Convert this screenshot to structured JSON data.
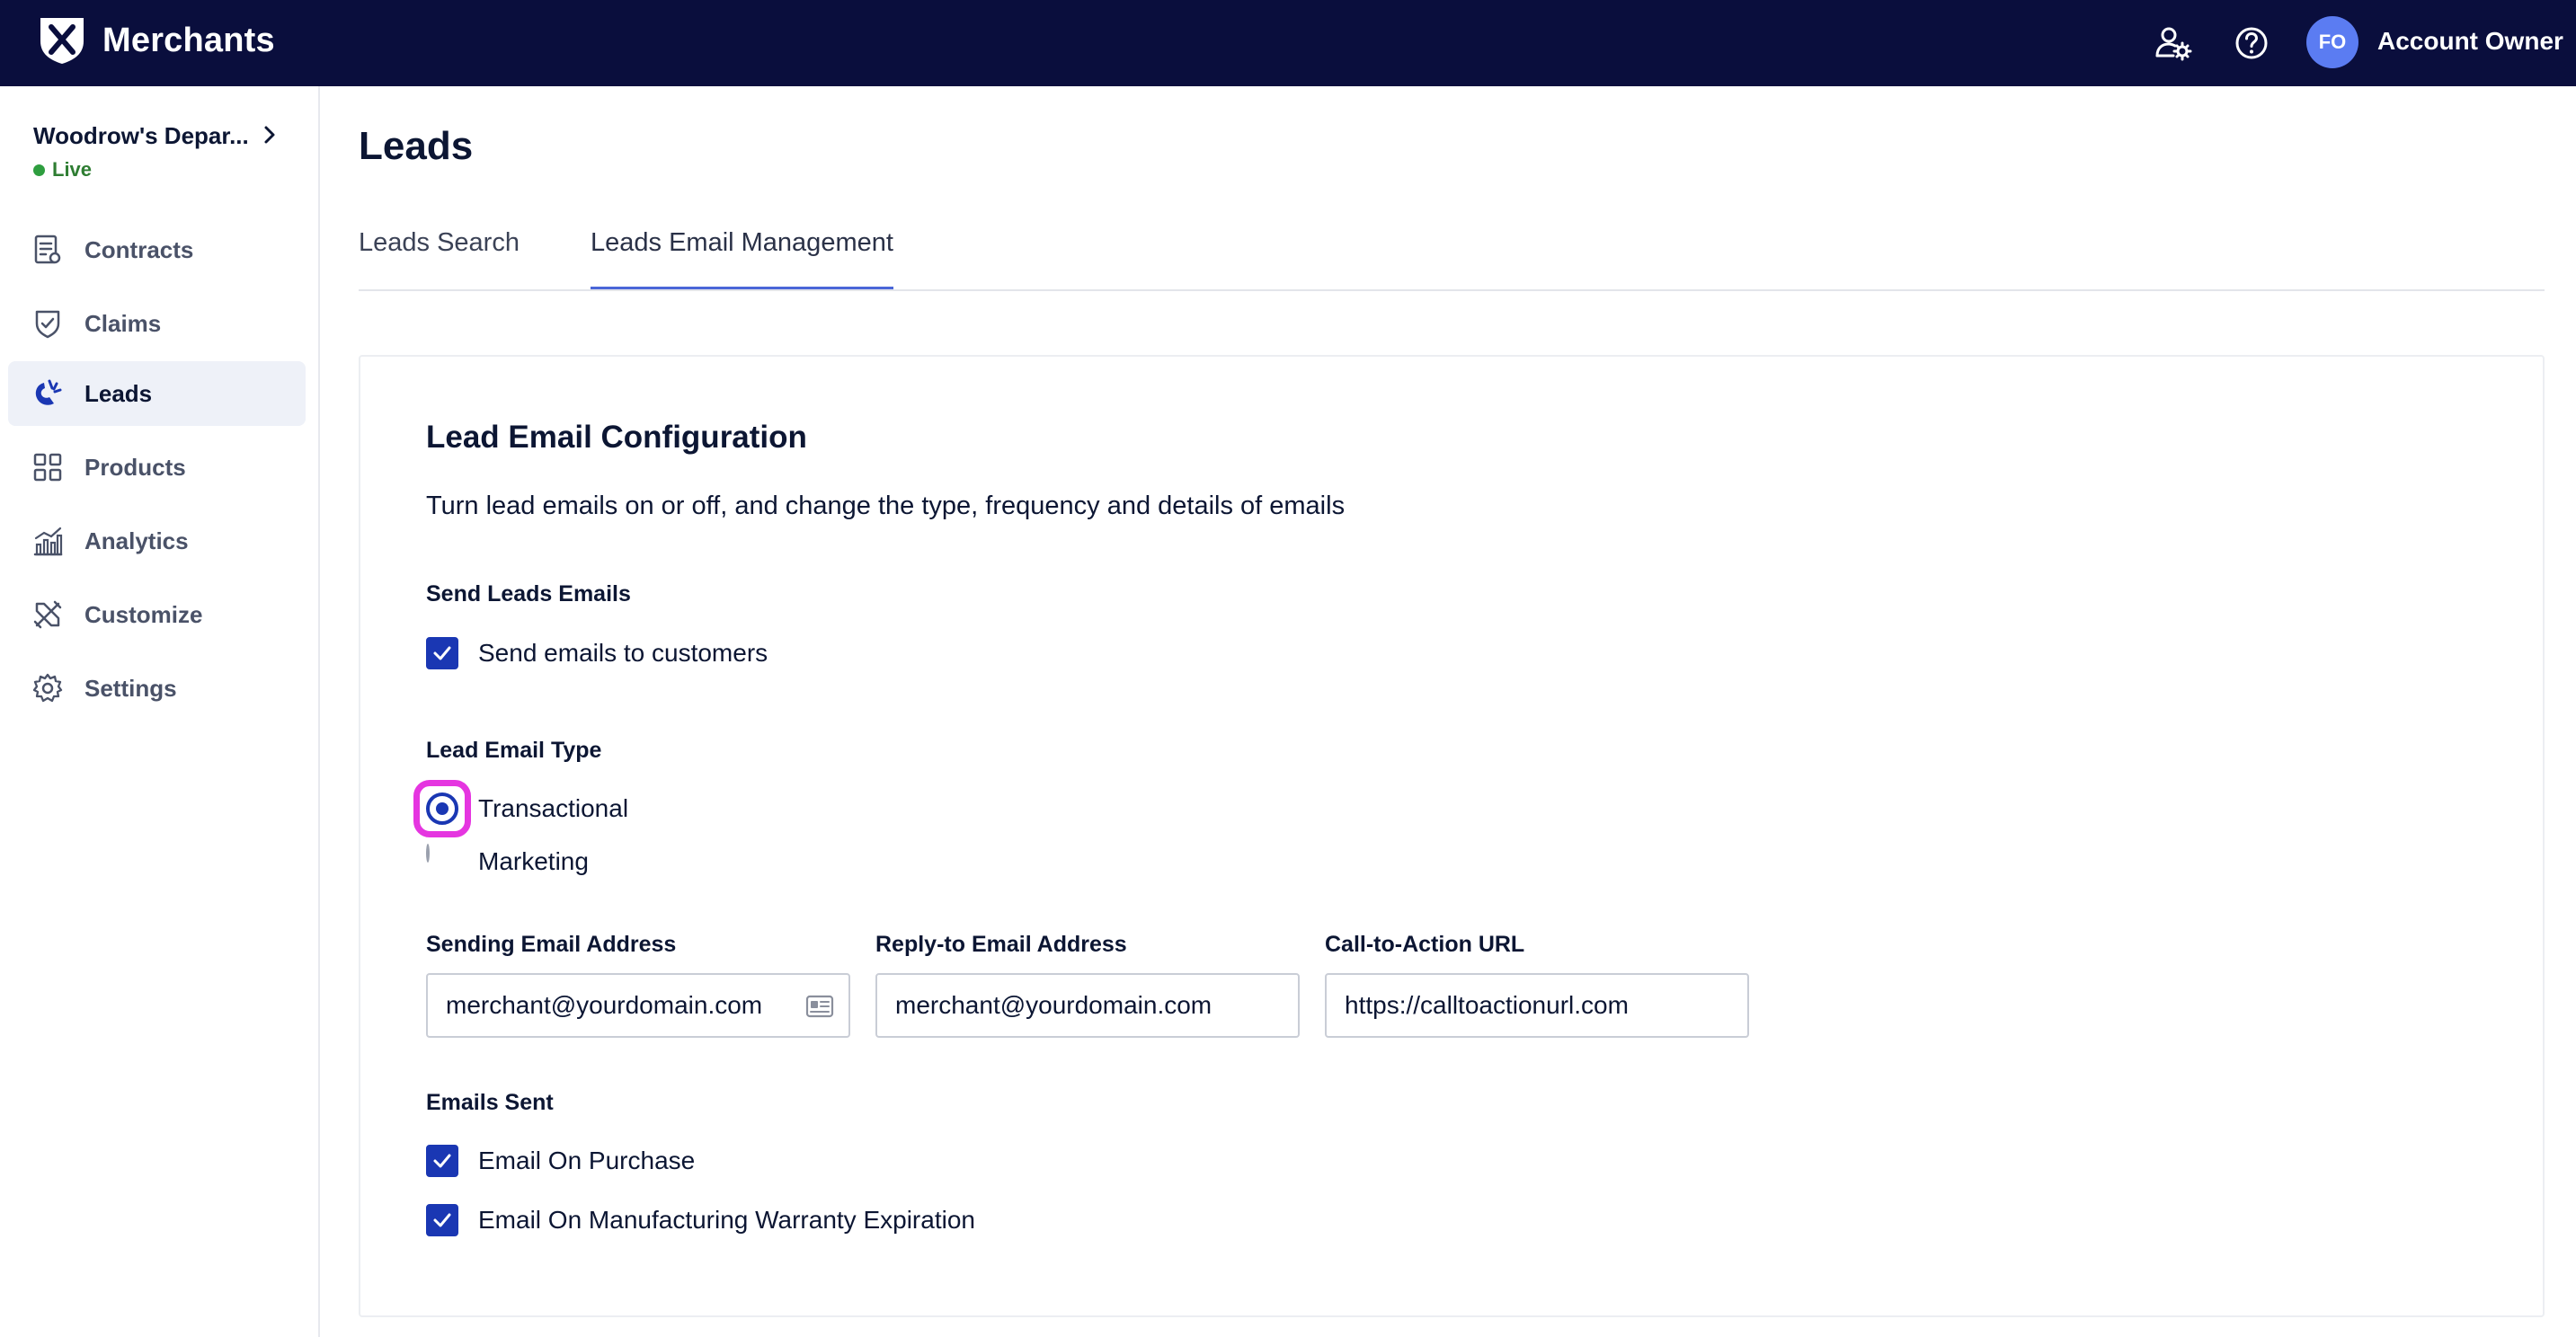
{
  "header": {
    "brand": "Merchants",
    "avatar_initials": "FO",
    "account_name": "Account Owner"
  },
  "sidebar": {
    "store_name": "Woodrow's Depar...",
    "store_status": "Live",
    "items": [
      {
        "label": "Contracts",
        "icon": "contract-icon"
      },
      {
        "label": "Claims",
        "icon": "shield-icon"
      },
      {
        "label": "Leads",
        "icon": "magnet-icon",
        "active": true
      },
      {
        "label": "Products",
        "icon": "grid-icon"
      },
      {
        "label": "Analytics",
        "icon": "bar-chart-icon"
      },
      {
        "label": "Customize",
        "icon": "tools-icon"
      },
      {
        "label": "Settings",
        "icon": "gear-icon"
      }
    ]
  },
  "main": {
    "title": "Leads",
    "tabs": [
      {
        "label": "Leads Search",
        "active": false
      },
      {
        "label": "Leads Email Management",
        "active": true
      }
    ]
  },
  "config": {
    "title": "Lead Email Configuration",
    "description": "Turn lead emails on or off, and change the type, frequency and details of emails",
    "send_section": {
      "label": "Send Leads Emails",
      "option": {
        "label": "Send emails to customers",
        "checked": true
      }
    },
    "type_section": {
      "label": "Lead Email Type",
      "options": [
        {
          "label": "Transactional",
          "selected": true
        },
        {
          "label": "Marketing",
          "selected": false
        }
      ]
    },
    "fields": {
      "sending": {
        "label": "Sending Email Address",
        "value": "merchant@yourdomain.com"
      },
      "reply_to": {
        "label": "Reply-to Email Address",
        "value": "merchant@yourdomain.com"
      },
      "cta": {
        "label": "Call-to-Action URL",
        "value": "https://calltoactionurl.com"
      }
    },
    "emails_sent": {
      "label": "Emails Sent",
      "options": [
        {
          "label": "Email On Purchase",
          "checked": true
        },
        {
          "label": "Email On Manufacturing Warranty Expiration",
          "checked": true
        }
      ]
    }
  },
  "colors": {
    "topbar": "#0a0e3d",
    "primary": "#1a37b3",
    "focus": "#e535e0",
    "live": "#2e9e3f",
    "avatar": "#5b7cf2"
  }
}
